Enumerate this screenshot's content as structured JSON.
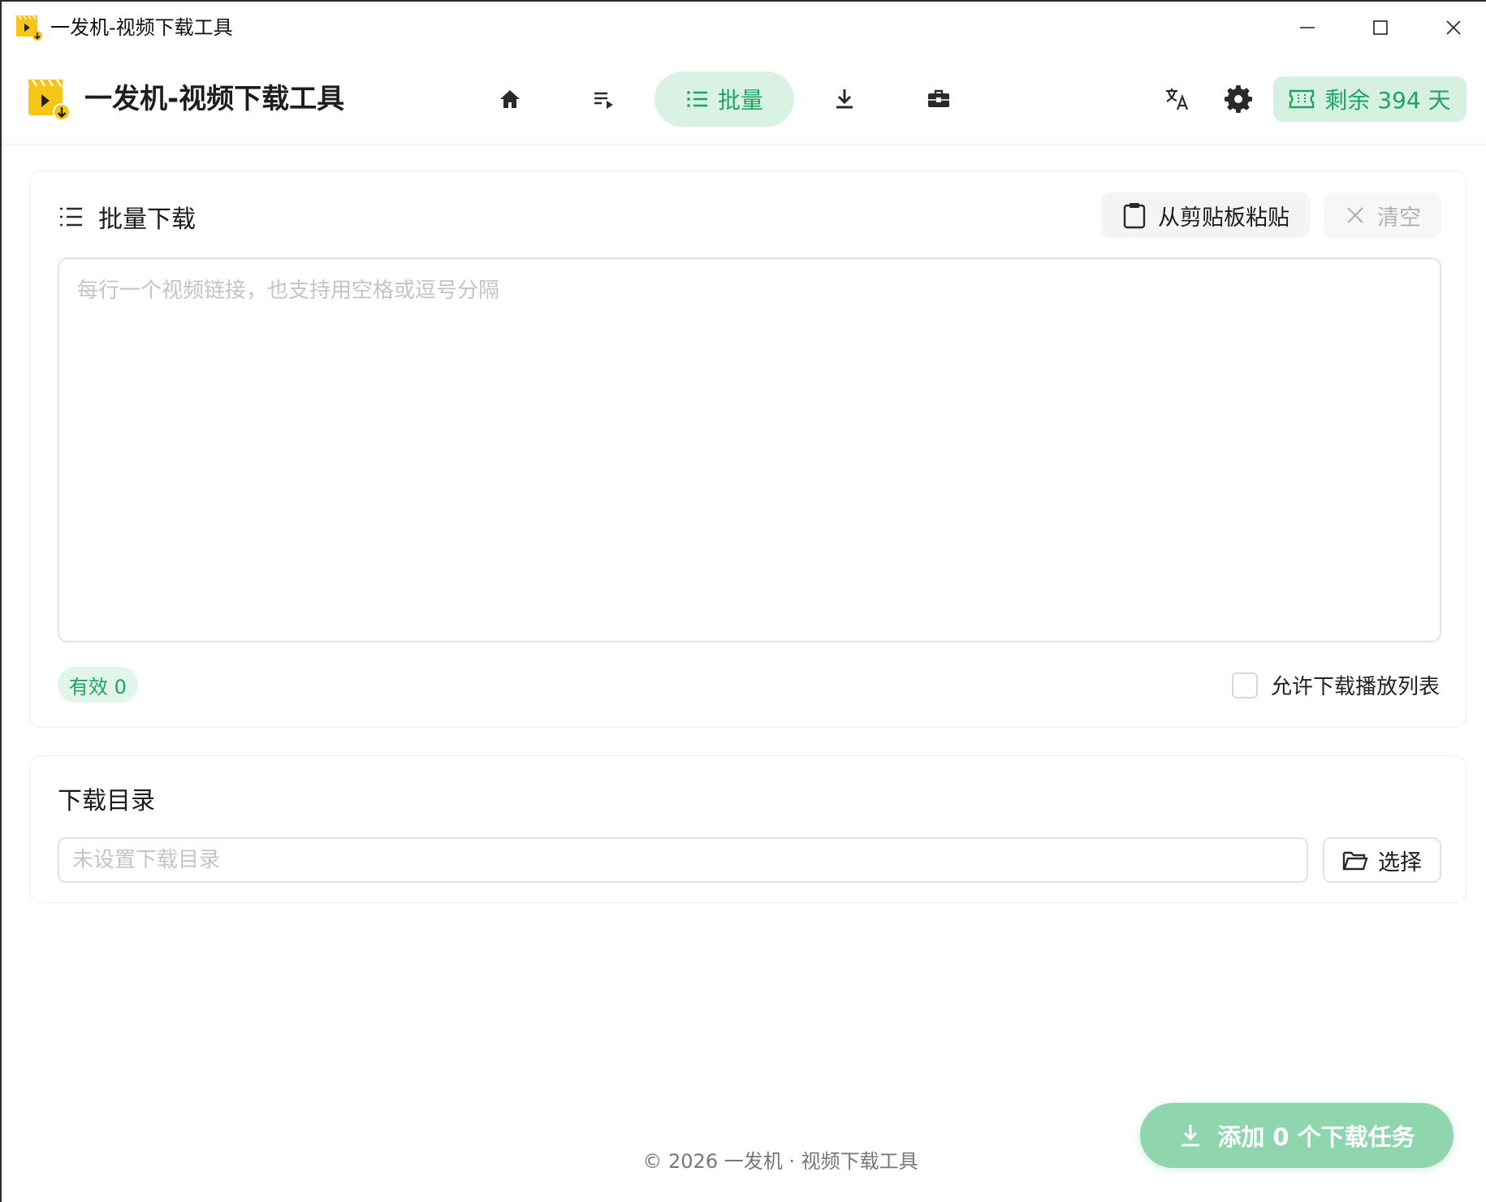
{
  "window": {
    "title": "一发机-视频下载工具"
  },
  "header": {
    "app_name": "一发机-视频下载工具",
    "nav": {
      "home_icon": "home-icon",
      "queue_icon": "queue-icon",
      "batch_label": "批量",
      "download_icon": "download-icon",
      "tools_icon": "toolbox-icon"
    },
    "license_label": "剩余 394 天"
  },
  "batch": {
    "title": "批量下载",
    "paste_label": "从剪贴板粘贴",
    "clear_label": "清空",
    "textarea_placeholder": "每行一个视频链接，也支持用空格或逗号分隔",
    "textarea_value": "",
    "valid_label": "有效 0",
    "allow_playlist_label": "允许下载播放列表",
    "allow_playlist_checked": false
  },
  "download_dir": {
    "title": "下载目录",
    "placeholder": "未设置下载目录",
    "value": "",
    "choose_label": "选择"
  },
  "footer": {
    "copyright": "© 2026 一发机 · 视频下载工具"
  },
  "actions": {
    "add_task_label": "添加 0 个下载任务"
  },
  "colors": {
    "accent": "#1ea362",
    "accent_bg": "#d9f2e3",
    "primary_button": "#8fd6ae",
    "logo_yellow": "#f5c518"
  }
}
